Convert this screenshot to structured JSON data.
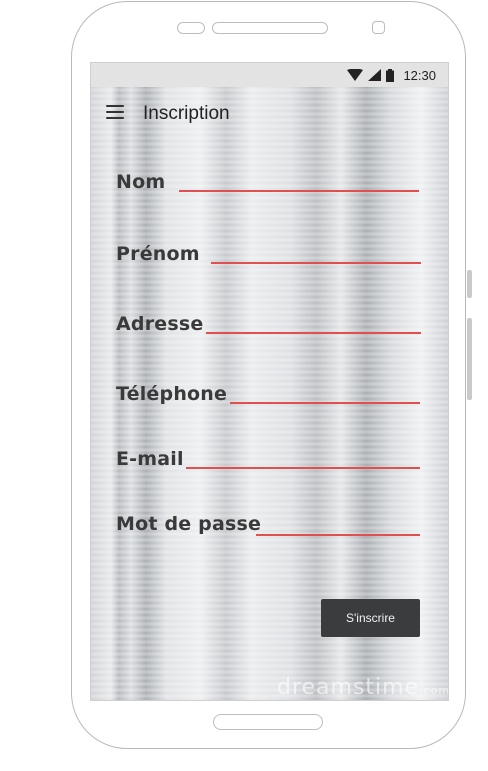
{
  "status_bar": {
    "time": "12:30",
    "icons": [
      "wifi-icon",
      "signal-icon",
      "battery-icon"
    ]
  },
  "app_bar": {
    "menu_icon": "hamburger-menu-icon",
    "title": "Inscription"
  },
  "form": {
    "fields": [
      {
        "label": "Nom"
      },
      {
        "label": "Prénom"
      },
      {
        "label": "Adresse"
      },
      {
        "label": "Téléphone"
      },
      {
        "label": "E-mail"
      },
      {
        "label": "Mot de passe"
      }
    ],
    "submit_label": "S'inscrire"
  },
  "watermark": {
    "text": "dreamstime",
    "suffix": ".com"
  },
  "colors": {
    "underline": "#e05050",
    "button_bg": "#3a3c3e",
    "status_bar_bg": "#e3e3e3"
  }
}
